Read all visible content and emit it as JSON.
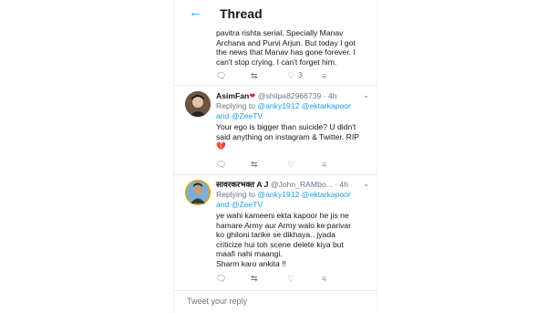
{
  "header": {
    "back_icon": "arrow-left-icon",
    "title": "Thread"
  },
  "tweet1": {
    "lines": [
      "pavitra rishta serial.  Specially Manav",
      "Archana and Purvi Arjun. But today I got",
      "the news that Manav has gone forever. I",
      "can't stop crying.  I can't forget him."
    ],
    "actions": {
      "reply_icon": "reply-icon",
      "retweet_icon": "retweet-icon",
      "like_icon": "heart-icon",
      "like_count": "3",
      "share_icon": "share-icon"
    }
  },
  "tweet2": {
    "name": "AsimFan",
    "name_emoji": "❤",
    "handle": "@shilpa82966739",
    "time": "· 4h",
    "replying_prefix": "Replying to",
    "replying_to_1": "@anky1912",
    "replying_to_2": "@ektarkapoor",
    "replying_and": "and",
    "replying_to_3": "@ZeeTV",
    "lines": [
      "Your ego is bigger than suicide? U didn't",
      "said anything on instagram & Twitter. RIP"
    ],
    "emoji": "💔",
    "actions": {
      "reply_icon": "reply-icon",
      "retweet_icon": "retweet-icon",
      "like_icon": "heart-icon",
      "share_icon": "share-icon"
    }
  },
  "tweet3": {
    "name": "सावरकरभक्त A J",
    "handle": "@John_RAMbo...",
    "time": "· 4h",
    "replying_prefix": "Replying to",
    "replying_to_1": "@anky1912",
    "replying_to_2": "@ektarkapoor",
    "replying_and": "and",
    "replying_to_3": "@ZeeTV",
    "lines": [
      "ye wahi kameeni ekta kapoor he jis ne",
      "hamare Army aur Army walo ke parivar",
      "ko ghiloni tarike se dikhaya.. jyada",
      "criticize hui toh scene delete kiya but",
      "maafi nahi maangi.",
      "Sharm karo ankita !!"
    ],
    "actions": {
      "reply_icon": "reply-icon",
      "retweet_icon": "retweet-icon",
      "like_icon": "heart-icon",
      "share_icon": "share-icon"
    }
  },
  "composer": {
    "placeholder": "Tweet your reply"
  }
}
